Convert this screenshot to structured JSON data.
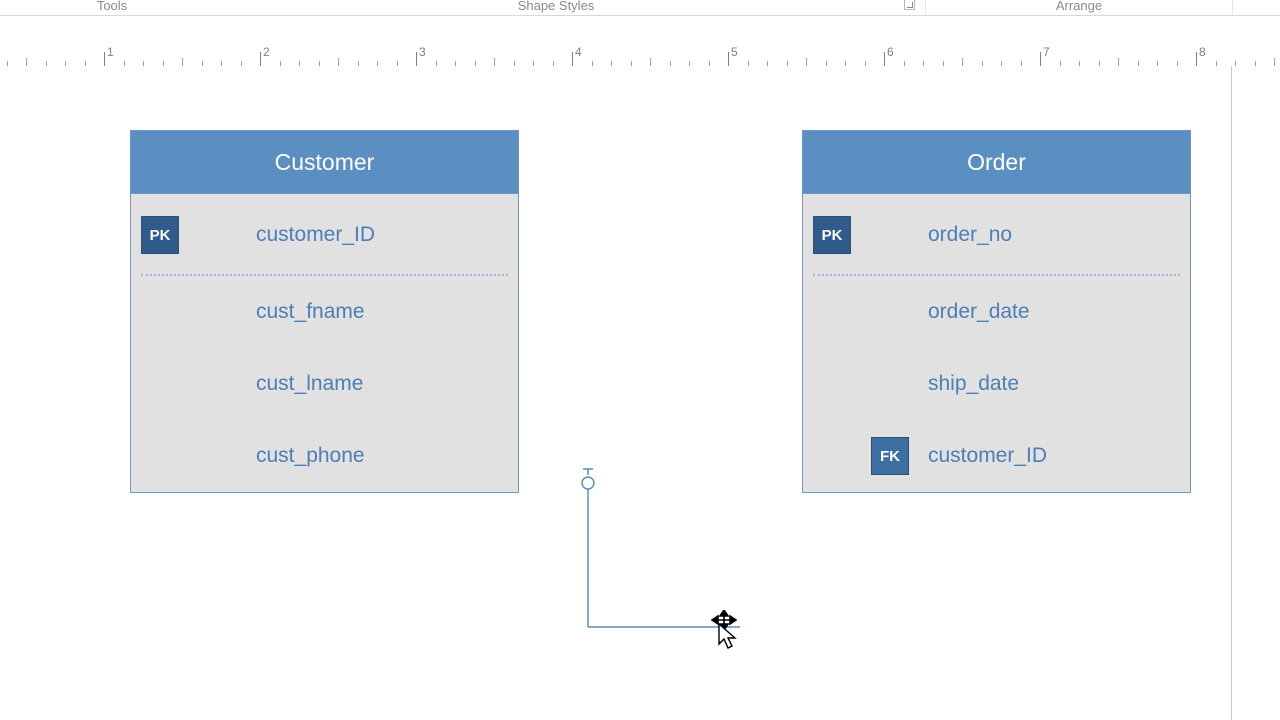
{
  "ribbon": {
    "groups": {
      "tools": "Tools",
      "shape_styles": "Shape Styles",
      "arrange": "Arrange"
    }
  },
  "ruler": {
    "labels": [
      "1",
      "2",
      "3",
      "4",
      "5",
      "6",
      "7",
      "8"
    ]
  },
  "entities": {
    "customer": {
      "title": "Customer",
      "pk_badge": "PK",
      "fields": {
        "id": "customer_ID",
        "fname": "cust_fname",
        "lname": "cust_lname",
        "phone": "cust_phone"
      }
    },
    "order": {
      "title": "Order",
      "pk_badge": "PK",
      "fk_badge": "FK",
      "fields": {
        "no": "order_no",
        "date": "order_date",
        "ship": "ship_date",
        "cust_id": "customer_ID"
      }
    }
  }
}
